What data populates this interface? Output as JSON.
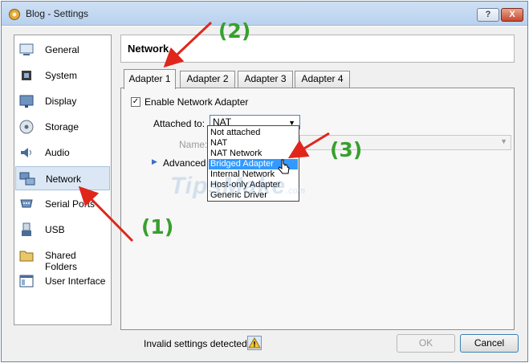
{
  "window": {
    "title": "Blog - Settings",
    "help_label": "?",
    "close_label": "X"
  },
  "sidebar": {
    "items": [
      {
        "label": "General",
        "icon": "general-icon"
      },
      {
        "label": "System",
        "icon": "system-icon"
      },
      {
        "label": "Display",
        "icon": "display-icon"
      },
      {
        "label": "Storage",
        "icon": "storage-icon"
      },
      {
        "label": "Audio",
        "icon": "audio-icon"
      },
      {
        "label": "Network",
        "icon": "network-icon",
        "active": true
      },
      {
        "label": "Serial Ports",
        "icon": "serial-ports-icon"
      },
      {
        "label": "USB",
        "icon": "usb-icon"
      },
      {
        "label": "Shared Folders",
        "icon": "shared-folders-icon"
      },
      {
        "label": "User Interface",
        "icon": "user-interface-icon"
      }
    ]
  },
  "main": {
    "title": "Network",
    "tabs": [
      {
        "label": "Adapter 1",
        "active": true
      },
      {
        "label": "Adapter 2"
      },
      {
        "label": "Adapter 3"
      },
      {
        "label": "Adapter 4"
      }
    ],
    "enable_label": "Enable Network Adapter",
    "enable_checked": true,
    "attached_label": "Attached to:",
    "attached_value": "NAT",
    "name_label": "Name:",
    "advanced_label": "Advanced",
    "dropdown_options": [
      "Not attached",
      "NAT",
      "NAT Network",
      "Bridged Adapter",
      "Internal Network",
      "Host-only Adapter",
      "Generic Driver"
    ],
    "dropdown_highlighted": "Bridged Adapter"
  },
  "status": {
    "text": "Invalid settings detected"
  },
  "buttons": {
    "ok": "OK",
    "cancel": "Cancel"
  },
  "annotations": {
    "step1": "(1)",
    "step2": "(2)",
    "step3": "(3)"
  },
  "watermark": {
    "text": "TipsMake",
    "suffix": ".com"
  },
  "colors": {
    "annotation": "#37a02e",
    "arrow": "#e0261b",
    "selection": "#3399ff"
  }
}
